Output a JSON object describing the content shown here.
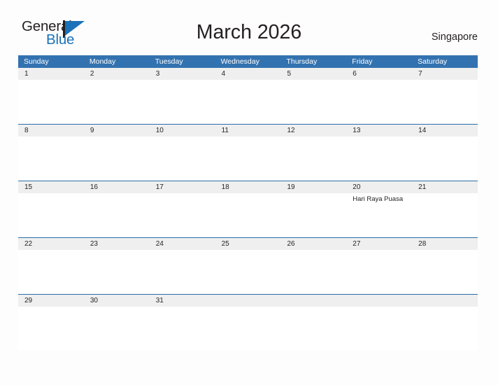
{
  "brand": {
    "name_part1": "General",
    "name_part2": "Blue",
    "flag_icon": "flag-triangle-icon",
    "colors": {
      "black": "#231f20",
      "blue": "#1b72b8"
    }
  },
  "header": {
    "title": "March 2026",
    "region": "Singapore"
  },
  "calendar": {
    "header_bg": "#3372b0",
    "header_text_color": "#ffffff",
    "day_strip_bg": "#efefef",
    "row_border": "#2a6ca8",
    "weekdays": [
      "Sunday",
      "Monday",
      "Tuesday",
      "Wednesday",
      "Thursday",
      "Friday",
      "Saturday"
    ],
    "weeks": [
      {
        "days": [
          {
            "num": "1",
            "events": []
          },
          {
            "num": "2",
            "events": []
          },
          {
            "num": "3",
            "events": []
          },
          {
            "num": "4",
            "events": []
          },
          {
            "num": "5",
            "events": []
          },
          {
            "num": "6",
            "events": []
          },
          {
            "num": "7",
            "events": []
          }
        ]
      },
      {
        "days": [
          {
            "num": "8",
            "events": []
          },
          {
            "num": "9",
            "events": []
          },
          {
            "num": "10",
            "events": []
          },
          {
            "num": "11",
            "events": []
          },
          {
            "num": "12",
            "events": []
          },
          {
            "num": "13",
            "events": []
          },
          {
            "num": "14",
            "events": []
          }
        ]
      },
      {
        "days": [
          {
            "num": "15",
            "events": []
          },
          {
            "num": "16",
            "events": []
          },
          {
            "num": "17",
            "events": []
          },
          {
            "num": "18",
            "events": []
          },
          {
            "num": "19",
            "events": []
          },
          {
            "num": "20",
            "events": [
              "Hari Raya Puasa"
            ]
          },
          {
            "num": "21",
            "events": []
          }
        ]
      },
      {
        "days": [
          {
            "num": "22",
            "events": []
          },
          {
            "num": "23",
            "events": []
          },
          {
            "num": "24",
            "events": []
          },
          {
            "num": "25",
            "events": []
          },
          {
            "num": "26",
            "events": []
          },
          {
            "num": "27",
            "events": []
          },
          {
            "num": "28",
            "events": []
          }
        ]
      },
      {
        "days": [
          {
            "num": "29",
            "events": []
          },
          {
            "num": "30",
            "events": []
          },
          {
            "num": "31",
            "events": []
          },
          {
            "num": "",
            "events": []
          },
          {
            "num": "",
            "events": []
          },
          {
            "num": "",
            "events": []
          },
          {
            "num": "",
            "events": []
          }
        ]
      }
    ]
  }
}
